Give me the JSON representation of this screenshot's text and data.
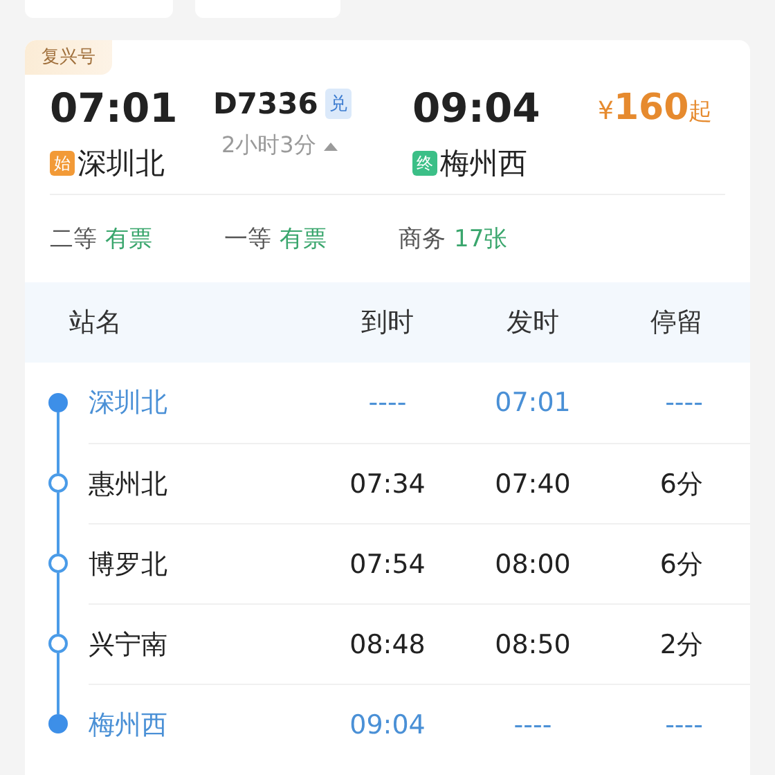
{
  "train": {
    "type_tag": "复兴号",
    "depart_time": "07:01",
    "number": "D7336",
    "number_badge": "兑",
    "duration": "2小时3分",
    "expanded": true,
    "arrive_time": "09:04",
    "price_symbol": "¥",
    "price": "160",
    "price_suffix": "起",
    "from": {
      "badge": "始",
      "name": "深圳北"
    },
    "to": {
      "badge": "终",
      "name": "梅州西"
    }
  },
  "seats": [
    {
      "class": "二等",
      "availability": "有票"
    },
    {
      "class": "一等",
      "availability": "有票"
    },
    {
      "class": "商务",
      "availability": "17张"
    }
  ],
  "stops_table": {
    "columns": [
      "站名",
      "到时",
      "发时",
      "停留"
    ],
    "rows": [
      {
        "kind": "terminal",
        "station": "深圳北",
        "arrive": "----",
        "depart": "07:01",
        "stay": "----"
      },
      {
        "kind": "stop",
        "station": "惠州北",
        "arrive": "07:34",
        "depart": "07:40",
        "stay": "6分"
      },
      {
        "kind": "stop",
        "station": "博罗北",
        "arrive": "07:54",
        "depart": "08:00",
        "stay": "6分"
      },
      {
        "kind": "stop",
        "station": "兴宁南",
        "arrive": "08:48",
        "depart": "08:50",
        "stay": "2分"
      },
      {
        "kind": "terminal",
        "station": "梅州西",
        "arrive": "09:04",
        "depart": "----",
        "stay": "----"
      }
    ]
  }
}
